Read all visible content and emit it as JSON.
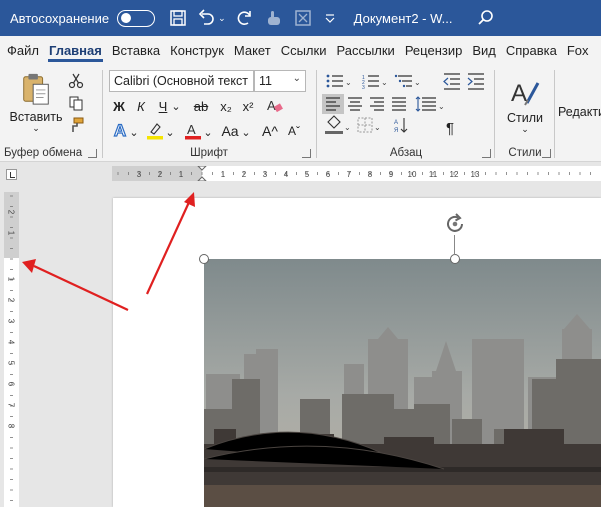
{
  "titlebar": {
    "autosave_label": "Автосохранение",
    "doc_title": "Документ2 - W...",
    "icons": [
      "toggle-switch-icon",
      "save-icon",
      "undo-icon",
      "redo-icon",
      "touch-mode-icon",
      "customize-qat-icon",
      "search-icon"
    ]
  },
  "tabs": [
    "Файл",
    "Главная",
    "Вставка",
    "Конструк",
    "Макет",
    "Ссылки",
    "Рассылки",
    "Рецензир",
    "Вид",
    "Справка",
    "Fox"
  ],
  "active_tab": "Главная",
  "ribbon": {
    "clipboard": {
      "paste_label": "Вставить",
      "group_label": "Буфер обмена"
    },
    "font": {
      "font_name": "Calibri (Основной текст",
      "font_size": "11",
      "bold": "Ж",
      "italic": "К",
      "underline": "Ч",
      "strike": "ab",
      "subscript": "x₂",
      "superscript": "x²",
      "text_effects": "A",
      "font_color": "A",
      "change_case": "Aa",
      "grow": "A^",
      "shrink": "Aˇ",
      "group_label": "Шрифт"
    },
    "paragraph": {
      "group_label": "Абзац",
      "pilcrow": "¶"
    },
    "styles": {
      "label": "Стили",
      "group_label": "Стили"
    },
    "editing": {
      "label": "Редакти"
    }
  },
  "ruler": {
    "h_labels": [
      "3",
      "2",
      "1",
      "1",
      "2",
      "3",
      "4",
      "5",
      "6",
      "7",
      "8",
      "9",
      "10",
      "11",
      "12",
      "13"
    ],
    "v_labels": [
      "2",
      "1",
      "1",
      "2",
      "3",
      "4",
      "5",
      "6",
      "7",
      "8"
    ]
  },
  "colors": {
    "title_bar": "#2b579a",
    "accent": "#2b579a",
    "arrow": "#e02020",
    "font_color_underline": "#e02020",
    "highlight_yellow": "#f5e400"
  }
}
